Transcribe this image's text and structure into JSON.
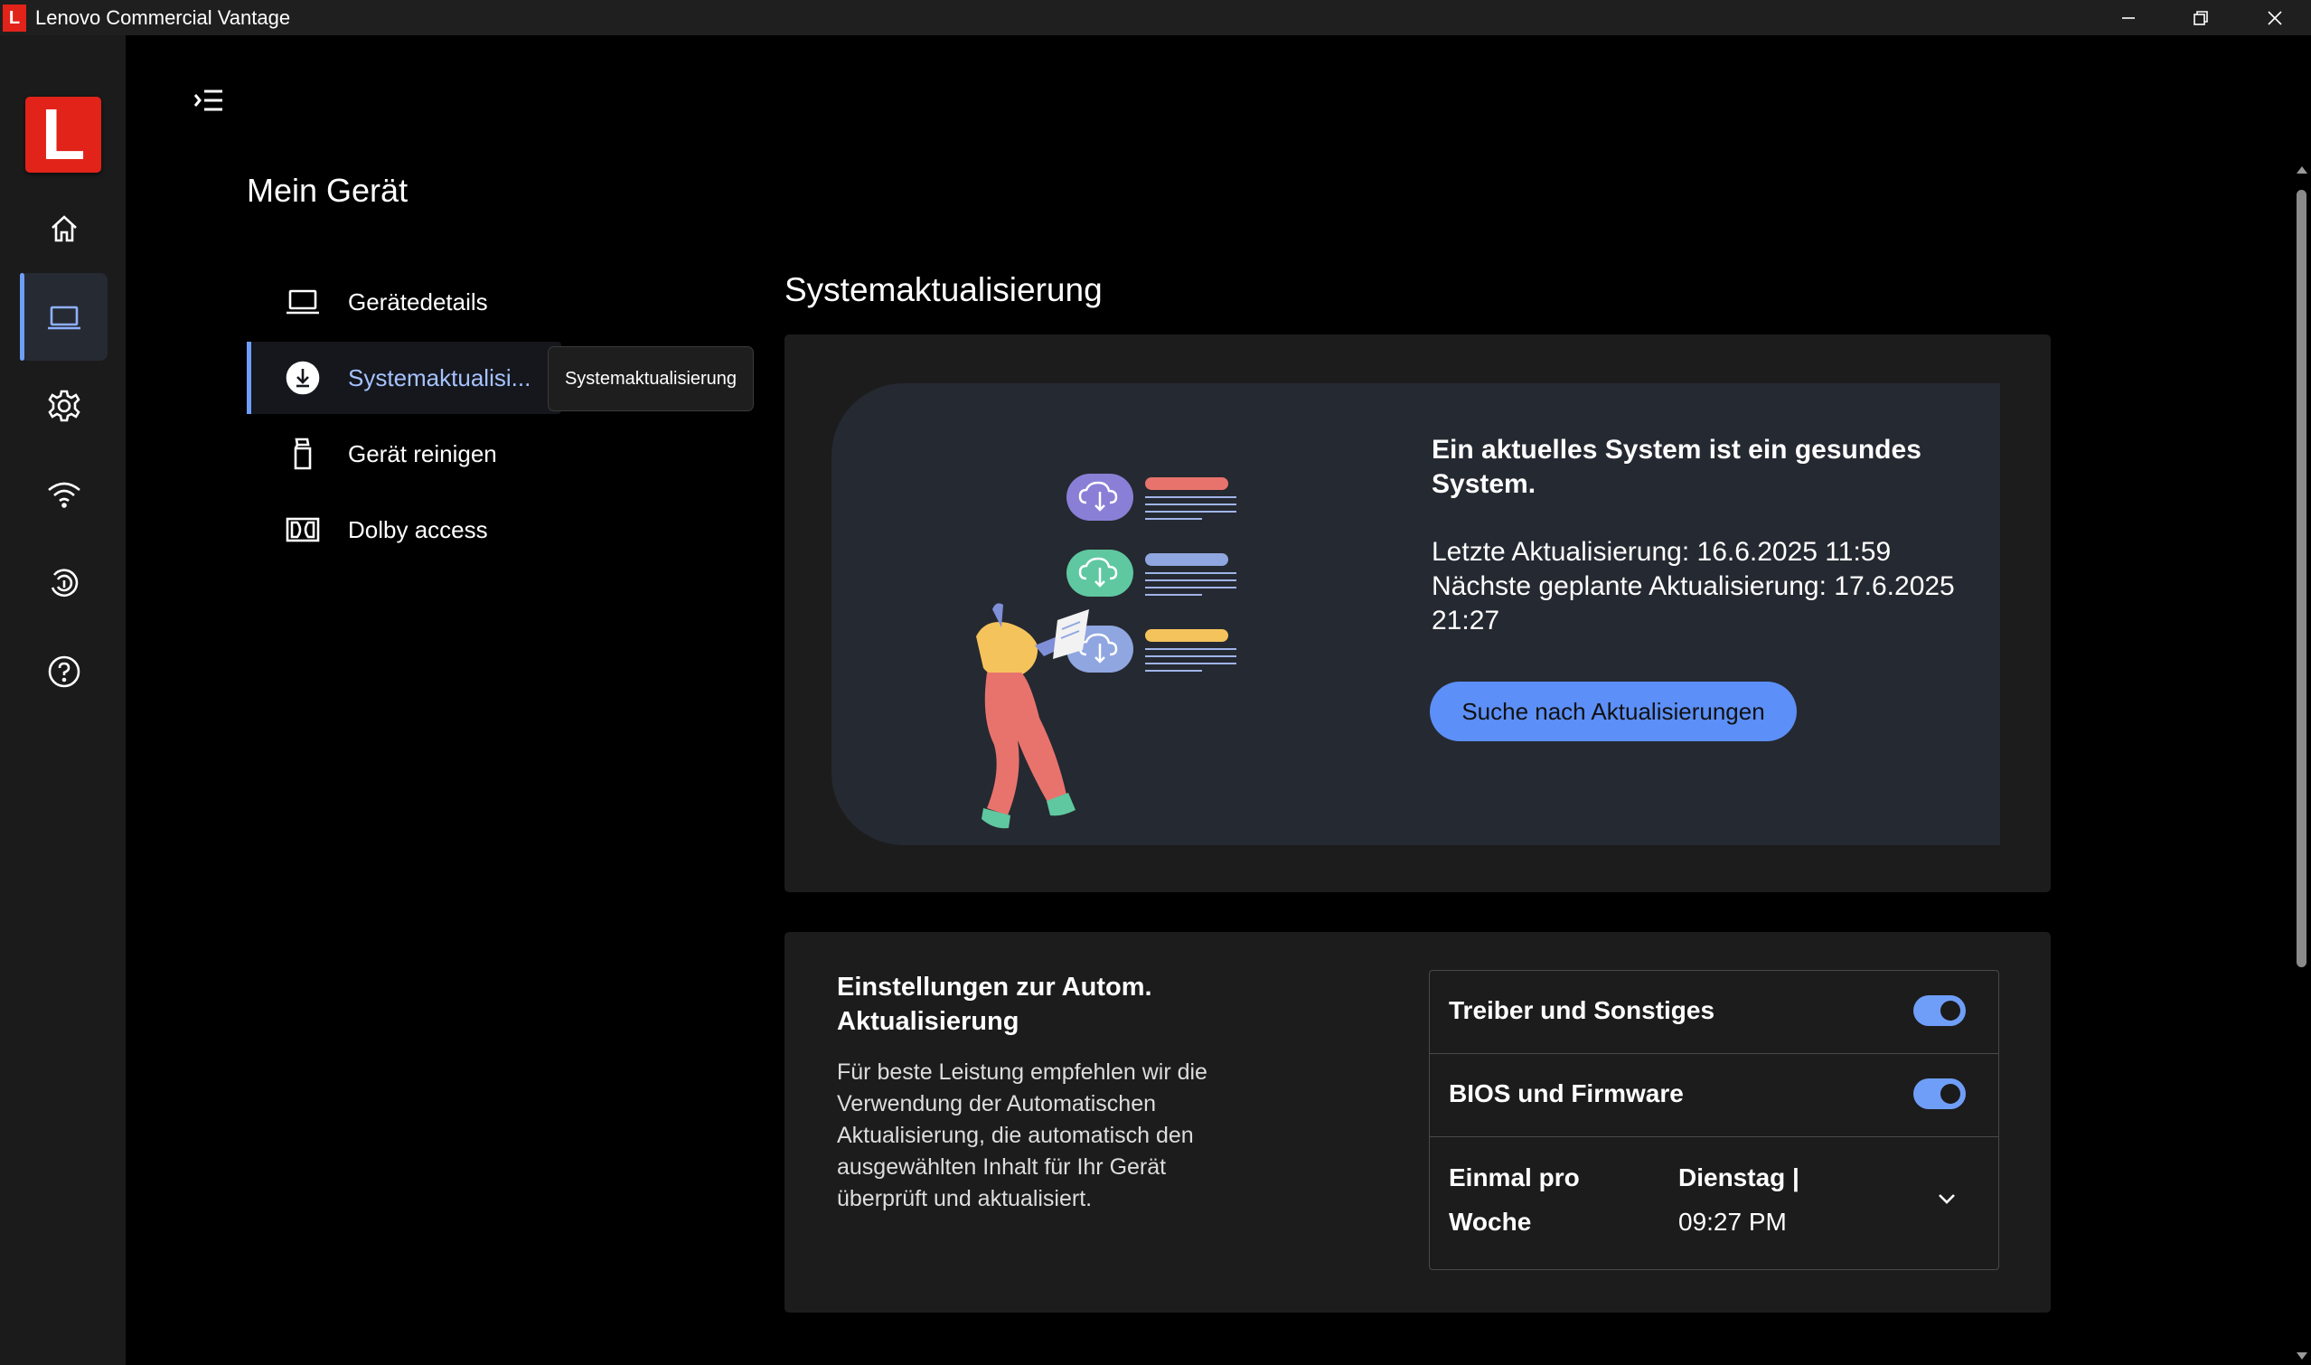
{
  "window": {
    "title": "Lenovo Commercial Vantage",
    "logo_small": "L"
  },
  "rail": {
    "logo_letter": "L",
    "items": [
      {
        "icon": "home-icon"
      },
      {
        "icon": "laptop-icon",
        "active": true
      },
      {
        "icon": "gear-icon"
      },
      {
        "icon": "wifi-icon"
      },
      {
        "icon": "fingerprint-icon"
      },
      {
        "icon": "help-icon"
      }
    ]
  },
  "page": {
    "title": "Mein Gerät"
  },
  "subnav": {
    "items": [
      {
        "label": "Gerätedetails",
        "icon": "laptop-icon"
      },
      {
        "label": "Systemaktualisi...",
        "icon": "download-icon",
        "active": true
      },
      {
        "label": "Gerät reinigen",
        "icon": "spray-bottle-icon"
      },
      {
        "label": "Dolby access",
        "icon": "dolby-icon"
      }
    ],
    "tooltip": "Systemaktualisierung"
  },
  "system_update": {
    "title": "Systemaktualisierung",
    "hero_heading": "Ein aktuelles System ist ein gesundes System.",
    "last_update": "Letzte Aktualisierung: 16.6.2025 11:59",
    "next_update": "Nächste geplante Aktualisierung: 17.6.2025 21:27",
    "check_button": "Suche nach Aktualisierungen",
    "colors": {
      "accent": "#5c8ff7",
      "purple": "#8a7fd6",
      "teal": "#5fc8a0",
      "coral": "#e8736d",
      "yellow": "#f5c35c"
    }
  },
  "auto_update": {
    "title": "Einstellungen zur Autom. Aktualisierung",
    "description": "Für beste Leistung empfehlen wir die Verwendung der Automatischen Aktualisierung, die automatisch den ausgewählten Inhalt für Ihr Gerät überprüft und aktualisiert.",
    "drivers_label": "Treiber und Sonstiges",
    "drivers_on": true,
    "bios_label": "BIOS und Firmware",
    "bios_on": true,
    "schedule_label": "Einmal pro Woche",
    "schedule_day": "Dienstag |",
    "schedule_time": "09:27 PM"
  }
}
